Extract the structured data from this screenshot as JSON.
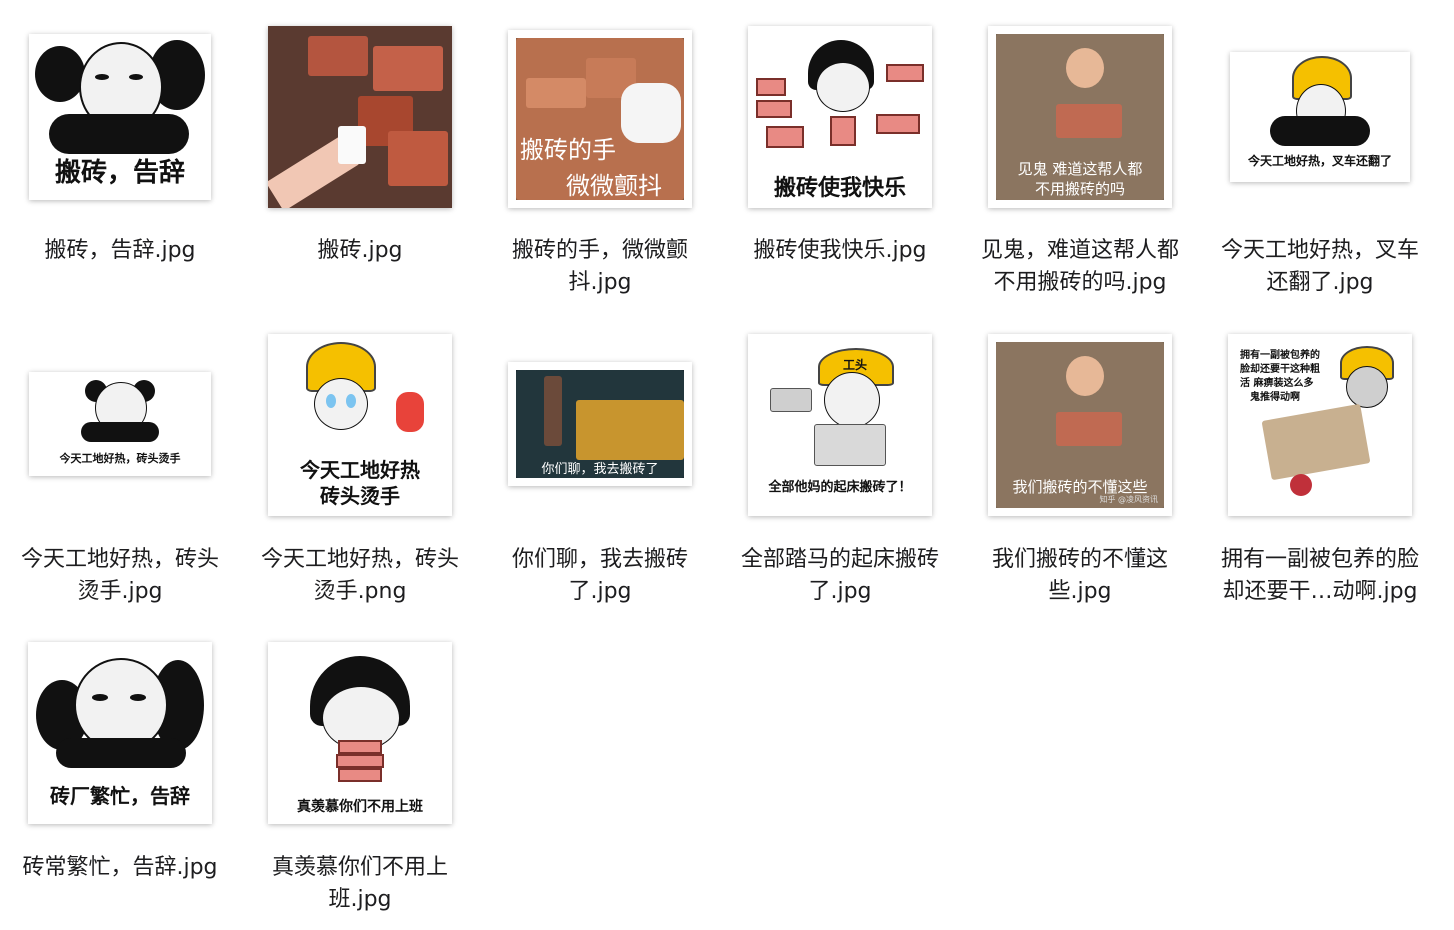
{
  "files": [
    {
      "name": "搬砖，告辞.jpg",
      "caption": "搬砖，告辞",
      "thumb": "panda-arm-wave"
    },
    {
      "name": "搬砖.jpg",
      "caption": "",
      "thumb": "hand-bricks-photo"
    },
    {
      "name": "搬砖的手，微微颤抖.jpg",
      "caption_lines": [
        "搬砖的手",
        "微微颤抖"
      ],
      "thumb": "glove-bricks-photo"
    },
    {
      "name": "搬砖使我快乐.jpg",
      "caption": "搬砖使我快乐",
      "thumb": "mushroom-head-bricks"
    },
    {
      "name": "见鬼，难道这帮人都不用搬砖的吗.jpg",
      "caption_lines": [
        "见鬼  难道这帮人都",
        "不用搬砖的吗"
      ],
      "thumb": "child-bricks-photo"
    },
    {
      "name": "今天工地好热，叉车还翻了.jpg",
      "caption": "今天工地好热，叉车还翻了",
      "thumb": "panda-hardhat"
    },
    {
      "name": "今天工地好热，砖头烫手.jpg",
      "caption": "今天工地好热，砖头烫手",
      "thumb": "panda-small"
    },
    {
      "name": "今天工地好热，砖头烫手.png",
      "caption_lines": [
        "今天工地好热",
        "砖头烫手"
      ],
      "thumb": "panda-hardhat-crying"
    },
    {
      "name": "你们聊，我去搬砖了.jpg",
      "caption": "你们聊，我去搬砖了",
      "thumb": "gold-bars-photo"
    },
    {
      "name": "全部踏马的起床搬砖了.jpg",
      "caption": "全部他妈的起床搬砖了！",
      "hat_label": "工头",
      "thumb": "foreman-megaphone"
    },
    {
      "name": "我们搬砖的不懂这些.jpg",
      "caption": "我们搬砖的不懂这些",
      "watermark": "知乎 @凌风资讯",
      "thumb": "child-bricks-photo"
    },
    {
      "name": "拥有一副被包养的脸却还要干...动啊.jpg",
      "caption_lines": [
        "拥有一副被包养的",
        "脸却还要干这种粗",
        "活  麻痹装这么多",
        "鬼推得动啊"
      ],
      "thumb": "cart-bricks"
    },
    {
      "name": "砖常繁忙，告辞.jpg",
      "caption": "砖厂繁忙，告辞",
      "thumb": "panda-arm-wave"
    },
    {
      "name": "真羡慕你们不用上班.jpg",
      "caption": "真羡慕你们不用上班",
      "thumb": "mushroom-head-bricks"
    }
  ],
  "display_names": [
    [
      "搬砖，告辞.jpg"
    ],
    [
      "搬砖.jpg"
    ],
    [
      "搬砖的手，微微颤",
      "抖.jpg"
    ],
    [
      "搬砖使我快乐.jpg"
    ],
    [
      "见鬼，难道这帮人都",
      "不用搬砖的吗.jpg"
    ],
    [
      "今天工地好热，叉车",
      "还翻了.jpg"
    ],
    [
      "今天工地好热，砖头",
      "烫手.jpg"
    ],
    [
      "今天工地好热，砖头",
      "烫手.png"
    ],
    [
      "你们聊，我去搬砖",
      "了.jpg"
    ],
    [
      "全部踏马的起床搬砖",
      "了.jpg"
    ],
    [
      "我们搬砖的不懂这",
      "些.jpg"
    ],
    [
      "拥有一副被包养的脸",
      "却还要干…动啊.jpg"
    ],
    [
      "砖常繁忙，告辞.jpg"
    ],
    [
      "真羡慕你们不用上",
      "班.jpg"
    ]
  ]
}
